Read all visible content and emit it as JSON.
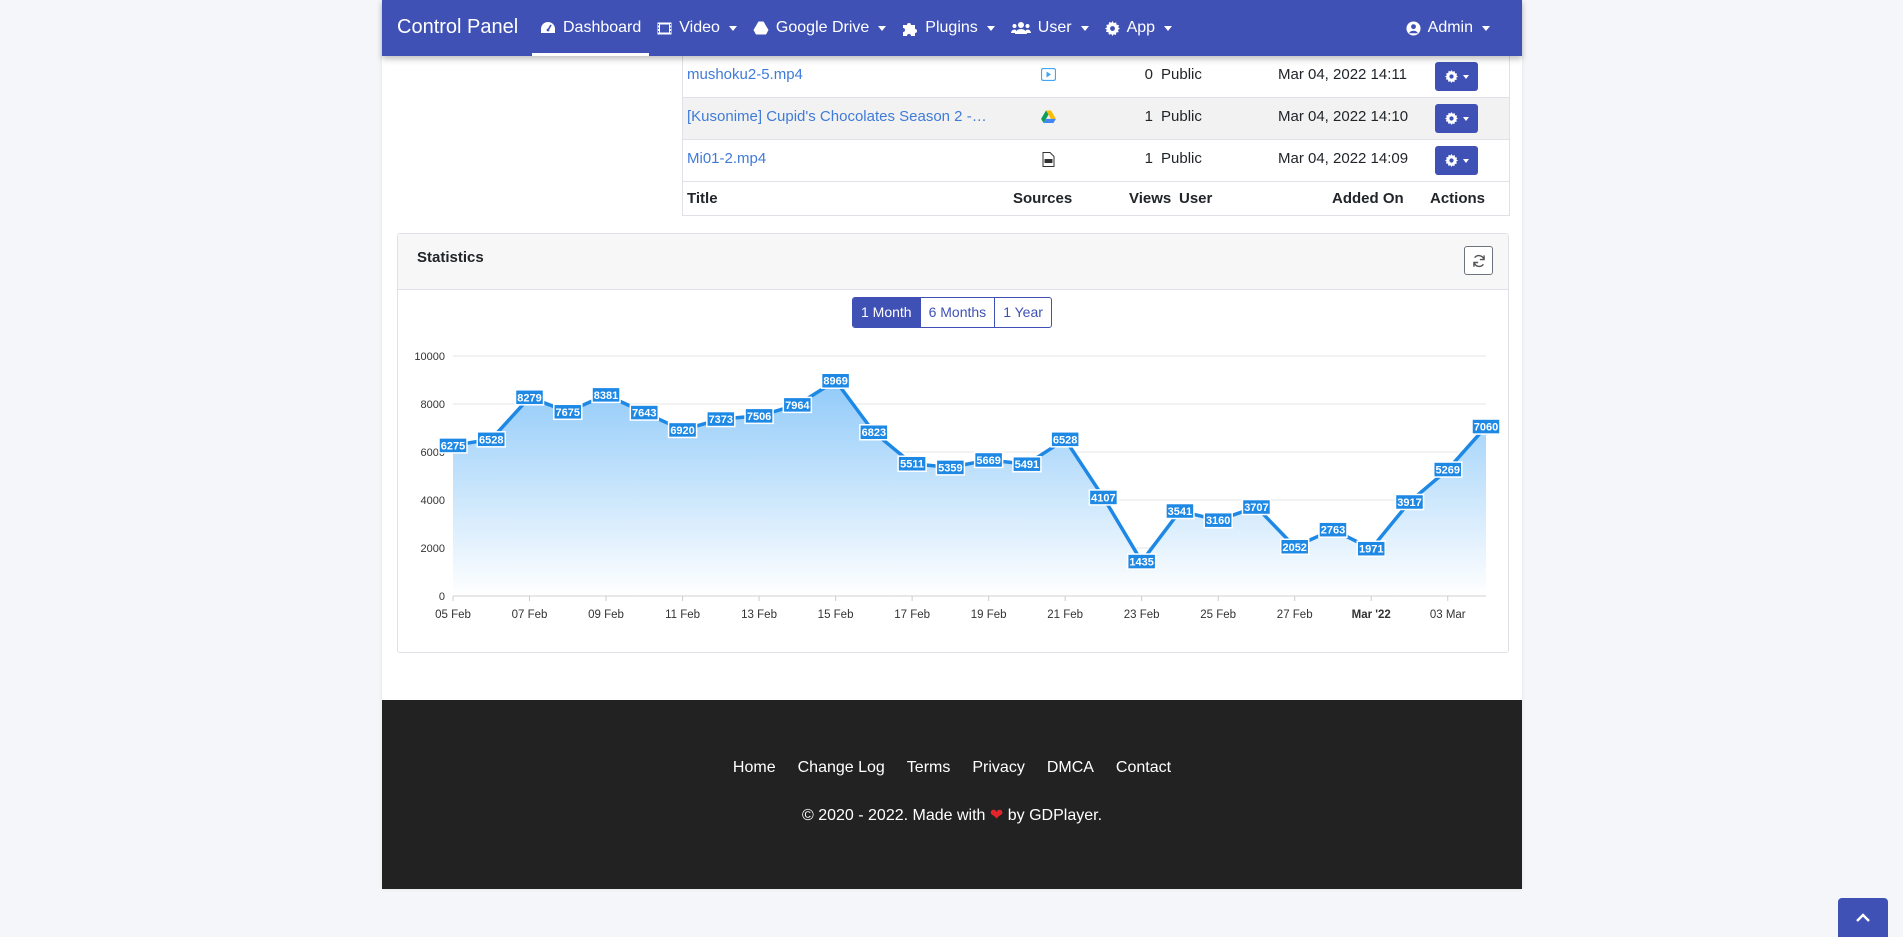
{
  "navbar": {
    "brand": "Control Panel",
    "items": [
      {
        "label": "Dashboard",
        "icon": "dashboard-icon"
      },
      {
        "label": "Video",
        "icon": "film-icon"
      },
      {
        "label": "Google Drive",
        "icon": "google-drive-icon"
      },
      {
        "label": "Plugins",
        "icon": "puzzle-icon"
      },
      {
        "label": "User",
        "icon": "users-icon"
      },
      {
        "label": "App",
        "icon": "gear-icon"
      }
    ],
    "account": {
      "label": "Admin",
      "icon": "user-circle-icon"
    }
  },
  "videos": {
    "rows": [
      {
        "title": "mushoku2-5.mp4",
        "source_icon": "video-play-icon",
        "views": "0",
        "user": "Public",
        "added_on": "Mar 04, 2022 14:11"
      },
      {
        "title": "[Kusonime] Cupid's Chocolates Season 2 - …",
        "source_icon": "google-drive-icon",
        "views": "1",
        "user": "Public",
        "added_on": "Mar 04, 2022 14:10"
      },
      {
        "title": "Mi01-2.mp4",
        "source_icon": "file-icon",
        "views": "1",
        "user": "Public",
        "added_on": "Mar 04, 2022 14:09"
      }
    ],
    "columns": {
      "title": "Title",
      "sources": "Sources",
      "views": "Views",
      "user": "User",
      "added_on": "Added On",
      "actions": "Actions"
    }
  },
  "statistics": {
    "title": "Statistics",
    "ranges": [
      "1 Month",
      "6 Months",
      "1 Year"
    ],
    "selected_range": "1 Month"
  },
  "chart_data": {
    "type": "area",
    "title": "",
    "xlabel": "",
    "ylabel": "",
    "ylim": [
      0,
      10000
    ],
    "yticks": [
      0,
      2000,
      4000,
      6000,
      8000,
      10000
    ],
    "grid": true,
    "x": [
      "05 Feb",
      "06 Feb",
      "07 Feb",
      "08 Feb",
      "09 Feb",
      "10 Feb",
      "11 Feb",
      "12 Feb",
      "13 Feb",
      "14 Feb",
      "15 Feb",
      "16 Feb",
      "17 Feb",
      "18 Feb",
      "19 Feb",
      "20 Feb",
      "21 Feb",
      "22 Feb",
      "23 Feb",
      "24 Feb",
      "25 Feb",
      "26 Feb",
      "27 Feb",
      "28 Feb",
      "Mar '22",
      "02 Mar",
      "03 Mar",
      "04 Mar"
    ],
    "xtick_labels": [
      "05 Feb",
      "07 Feb",
      "09 Feb",
      "11 Feb",
      "13 Feb",
      "15 Feb",
      "17 Feb",
      "19 Feb",
      "21 Feb",
      "23 Feb",
      "25 Feb",
      "27 Feb",
      "Mar '22",
      "03 Mar"
    ],
    "series": [
      {
        "values": [
          6275,
          6528,
          8279,
          7675,
          8381,
          7643,
          6920,
          7373,
          7506,
          7964,
          8969,
          6823,
          5511,
          5359,
          5669,
          5491,
          6528,
          4107,
          1435,
          3541,
          3160,
          3707,
          2052,
          2763,
          1971,
          3917,
          5269,
          7060
        ]
      }
    ],
    "colors": {
      "line": "#1e88e5",
      "fill_top": "#90caf9",
      "fill_bottom": "#ffffff"
    }
  },
  "footer": {
    "links": [
      "Home",
      "Change Log",
      "Terms",
      "Privacy",
      "DMCA",
      "Contact"
    ],
    "copyright_prefix": "© 2020 - 2022. Made with",
    "copyright_suffix": "by GDPlayer."
  },
  "colors": {
    "primary": "#3f51b5",
    "link": "#3f7bd9",
    "footer_bg": "#222222"
  }
}
